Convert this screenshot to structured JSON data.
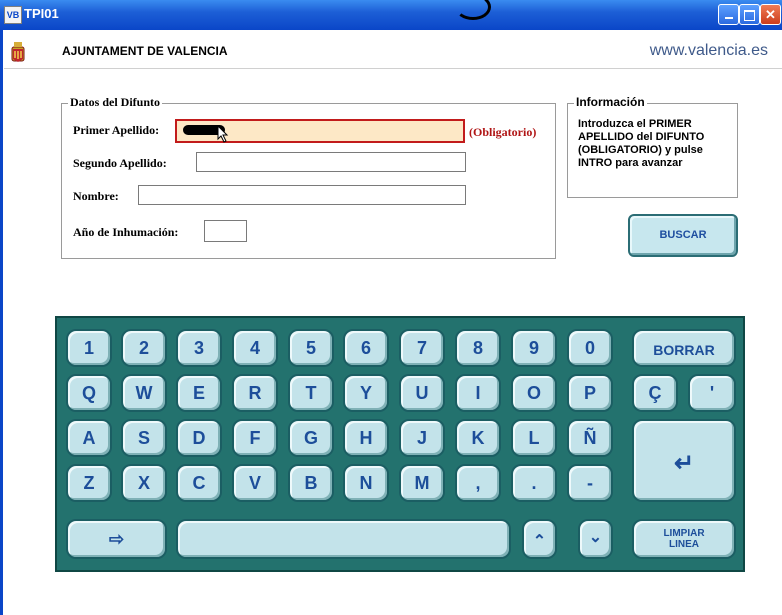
{
  "window": {
    "title": "TPI01",
    "icon_text": "VB",
    "controls": [
      "minimize",
      "maximize",
      "close"
    ]
  },
  "header": {
    "title": "AJUNTAMENT DE VALENCIA",
    "url": "www.valencia.es"
  },
  "form": {
    "legend": "Datos del Difunto",
    "first_surname_label": "Primer Apellido:",
    "first_surname_value": "",
    "required_note": "(Obligatorio)",
    "second_surname_label": "Segundo Apellido:",
    "second_surname_value": "",
    "name_label": "Nombre:",
    "name_value": "",
    "year_label": "Año de Inhumación:",
    "year_value": ""
  },
  "info": {
    "legend": "Información",
    "text": "Introduzca el PRIMER APELLIDO del DIFUNTO (OBLIGATORIO) y pulse INTRO para avanzar"
  },
  "buttons": {
    "search": "BUSCAR"
  },
  "keyboard": {
    "row1": [
      "1",
      "2",
      "3",
      "4",
      "5",
      "6",
      "7",
      "8",
      "9",
      "0"
    ],
    "row2": [
      "Q",
      "W",
      "E",
      "R",
      "T",
      "Y",
      "U",
      "I",
      "O",
      "P",
      "Ç",
      "'"
    ],
    "row3": [
      "A",
      "S",
      "D",
      "F",
      "G",
      "H",
      "J",
      "K",
      "L",
      "Ñ"
    ],
    "row4": [
      "Z",
      "X",
      "C",
      "V",
      "B",
      "N",
      "M",
      ",",
      ".",
      "-"
    ],
    "borrar": "BORRAR",
    "enter": "↵",
    "tab": "⇨",
    "up": "⌃",
    "down": "⌄",
    "clear_line": "LIMPIAR LINEA",
    "colors": {
      "panel": "#23726e",
      "key": "#c3e3ea",
      "key_text": "#1d4e9a"
    }
  },
  "colors": {
    "titlebar": "#1d5fd6",
    "required": "#b01515",
    "active_field_bg": "#fde8c6"
  }
}
